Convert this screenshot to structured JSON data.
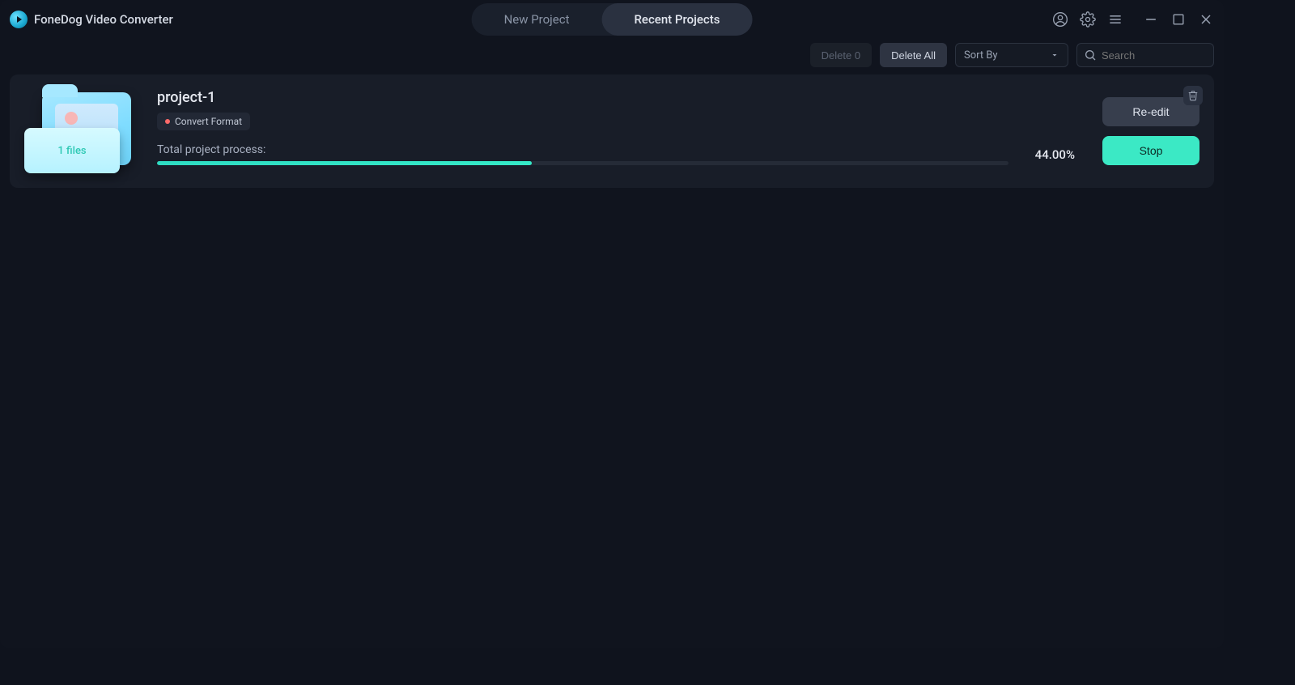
{
  "app": {
    "title": "FoneDog Video Converter"
  },
  "tabs": {
    "new_project": "New Project",
    "recent_projects": "Recent Projects"
  },
  "toolbar": {
    "delete_n": "Delete 0",
    "delete_all": "Delete All",
    "sort_by": "Sort By",
    "search_placeholder": "Search"
  },
  "project": {
    "name": "project-1",
    "tag": "Convert Format",
    "files_badge": "1 files",
    "process_label": "Total project process:",
    "percent_text": "44.00%",
    "percent_value": 44.0,
    "reedit": "Re-edit",
    "stop": "Stop"
  }
}
